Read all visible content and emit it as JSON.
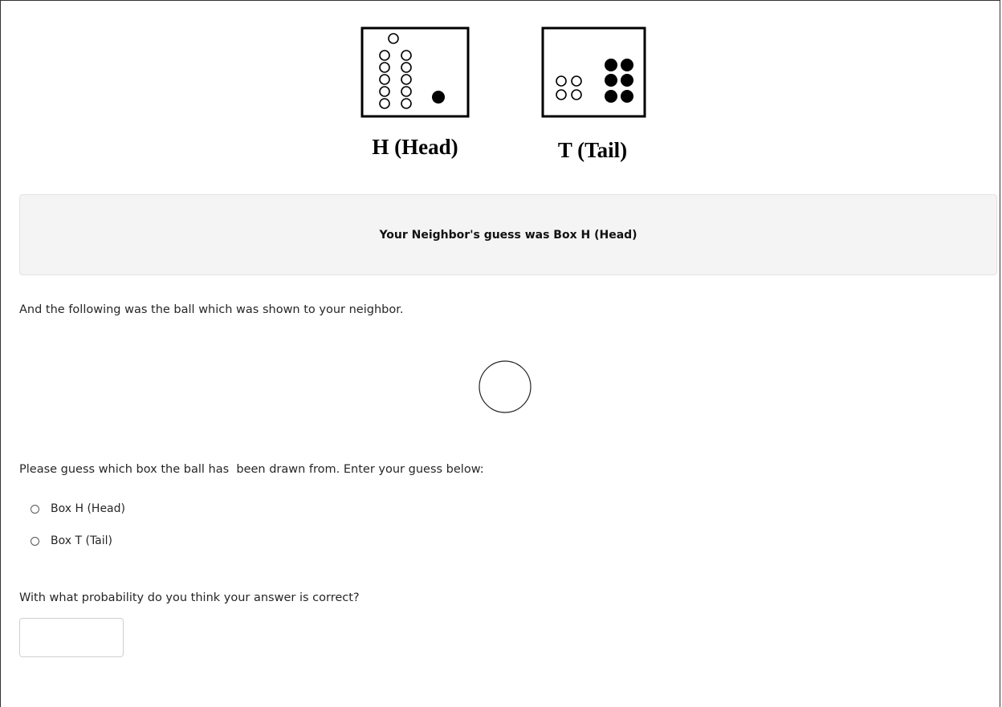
{
  "figure": {
    "box_h_caption": "H (Head)",
    "box_t_caption": "T (Tail)"
  },
  "banner": {
    "text": "Your Neighbor's guess was Box H (Head)"
  },
  "ball_intro": "And the following was the ball which was shown to your neighbor.",
  "ball_color": "white",
  "guess_prompt": "Please guess which box the ball has  been drawn from. Enter your guess below:",
  "options": [
    {
      "label": "Box H (Head)"
    },
    {
      "label": "Box T (Tail)"
    }
  ],
  "probability_prompt": "With what probability do you think your answer is correct?",
  "probability_input": {
    "value": "",
    "placeholder": ""
  }
}
